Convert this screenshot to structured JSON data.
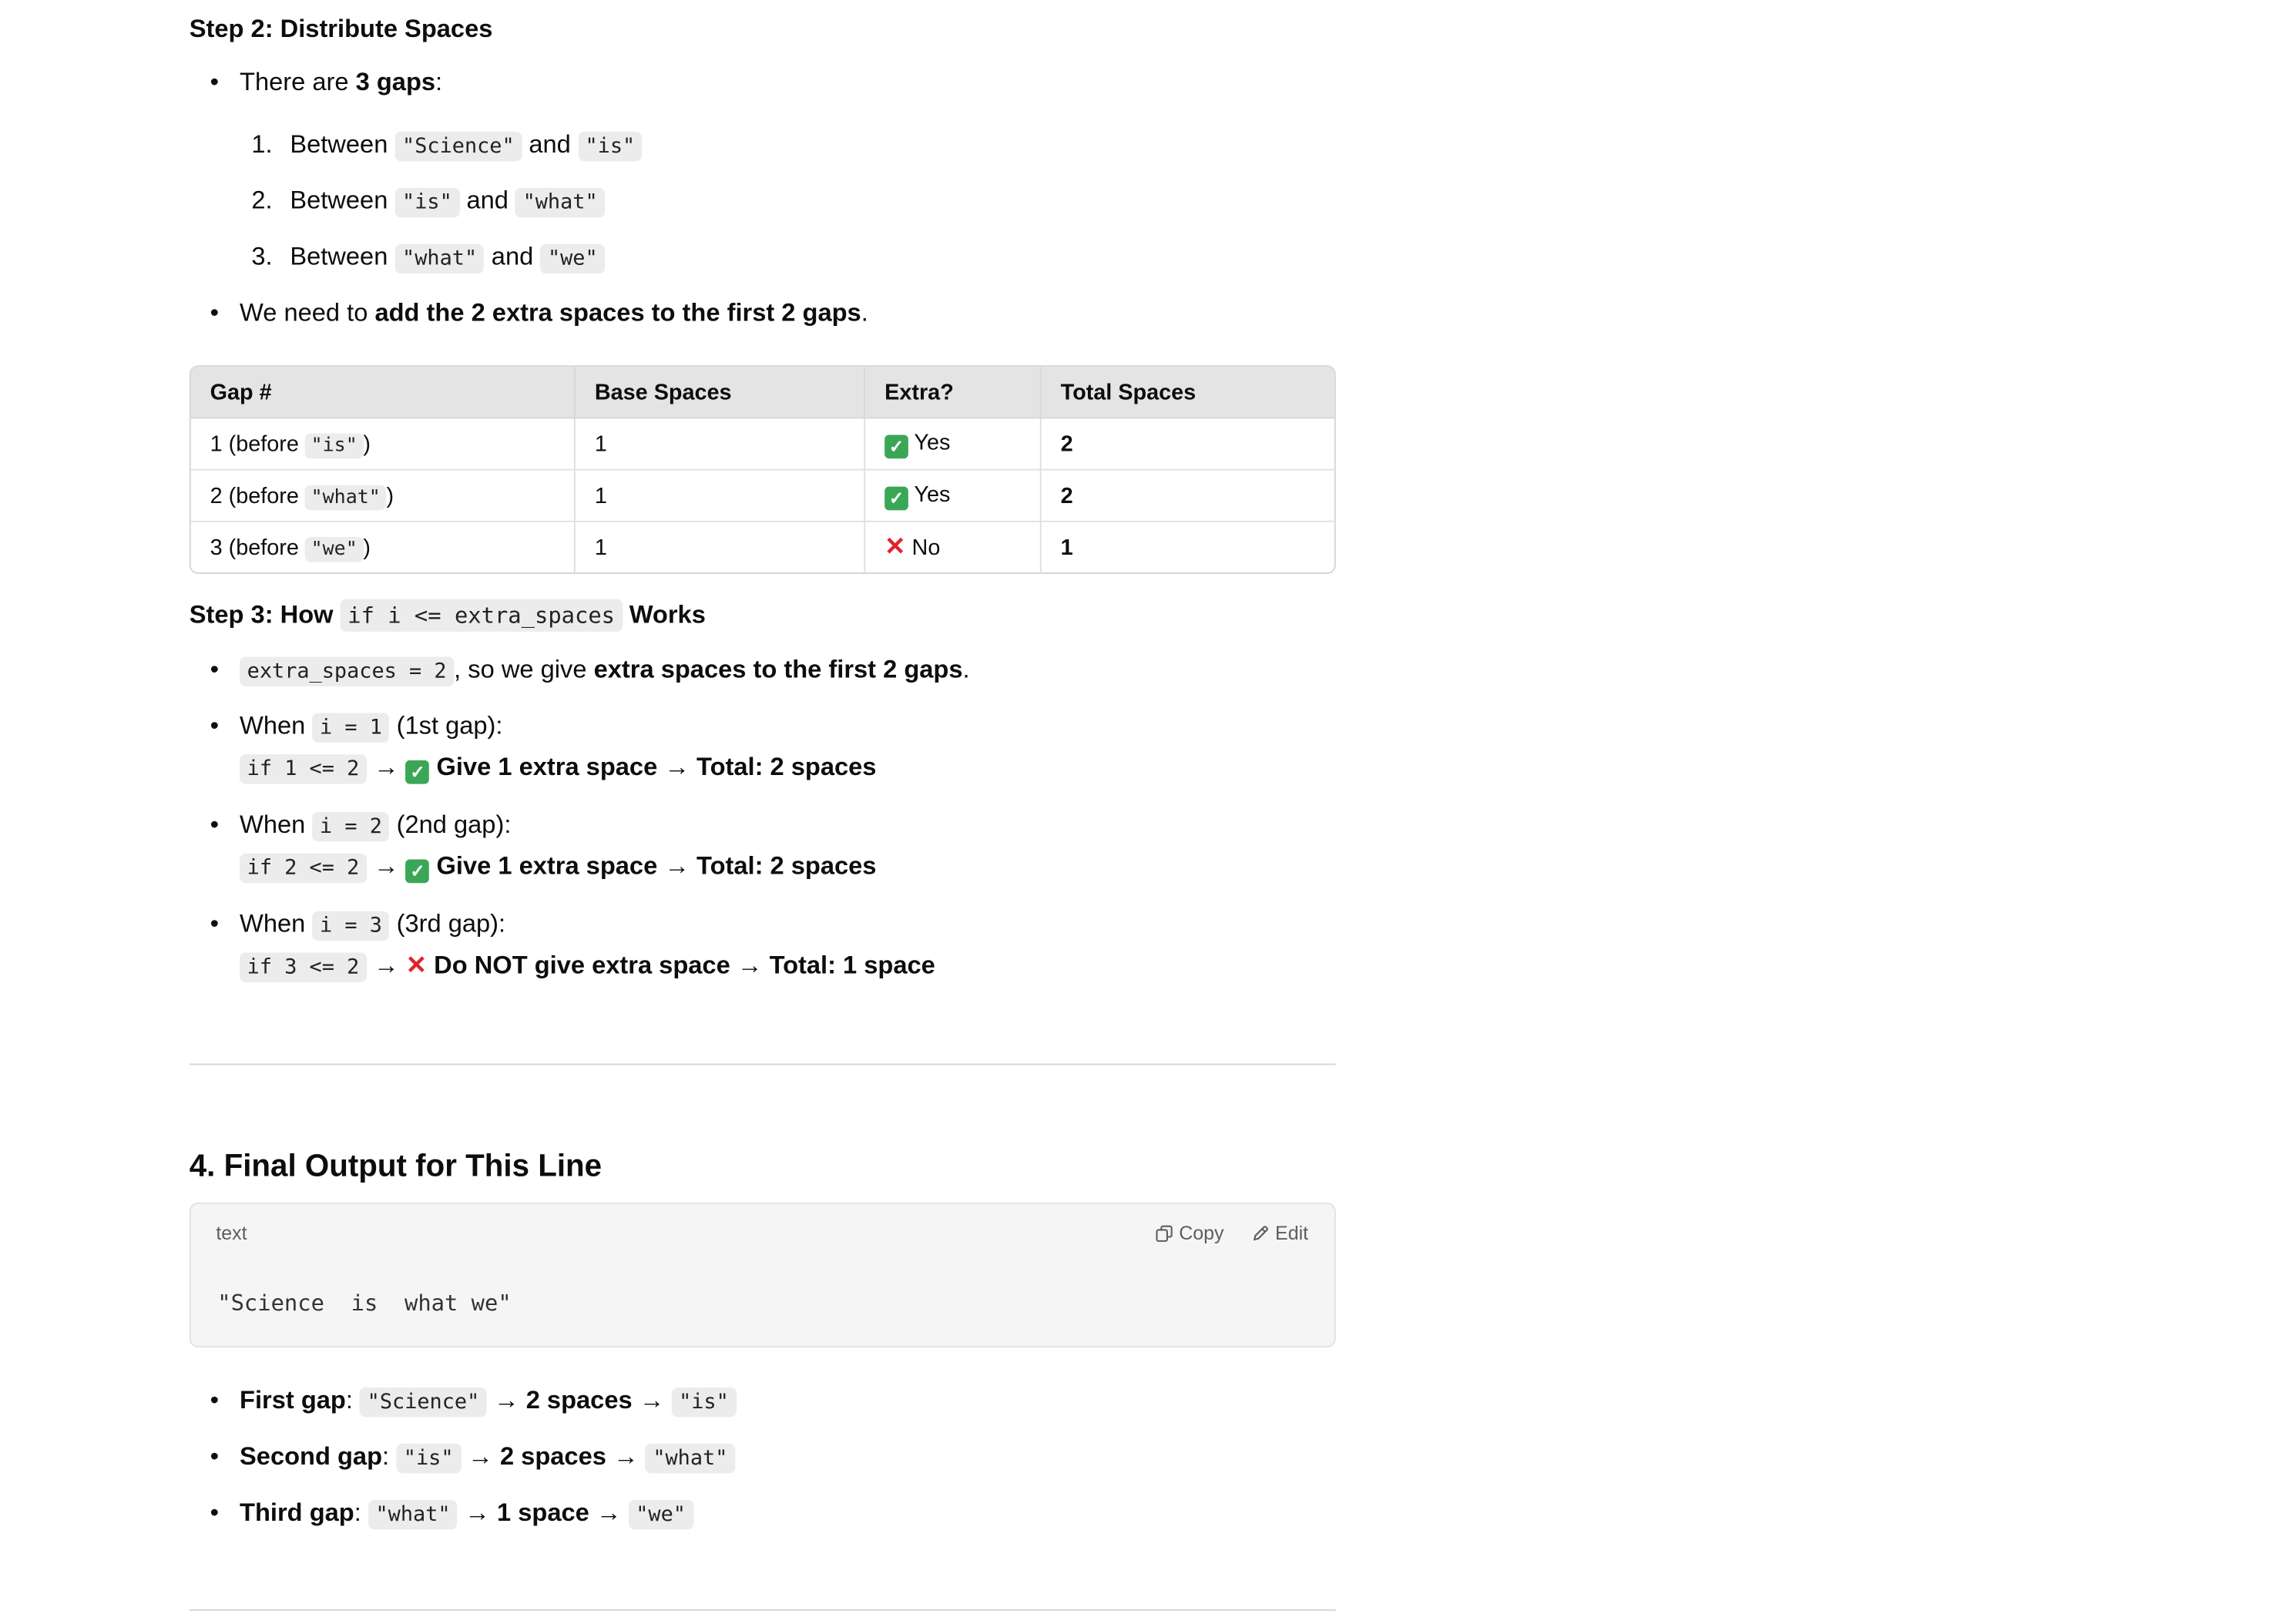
{
  "step2": {
    "heading": "Step 2: Distribute Spaces",
    "gaps_intro_prefix": "There are ",
    "gaps_intro_bold": "3 gaps",
    "gaps_intro_suffix": ":",
    "gaps": [
      {
        "num": "1.",
        "prefix": "Between ",
        "a": "\"Science\"",
        "mid": " and ",
        "b": "\"is\""
      },
      {
        "num": "2.",
        "prefix": "Between ",
        "a": "\"is\"",
        "mid": " and ",
        "b": "\"what\""
      },
      {
        "num": "3.",
        "prefix": "Between ",
        "a": "\"what\"",
        "mid": " and ",
        "b": "\"we\""
      }
    ],
    "need_prefix": "We need to ",
    "need_bold": "add the 2 extra spaces to the first 2 gaps",
    "need_suffix": "."
  },
  "table": {
    "headers": [
      "Gap #",
      "Base Spaces",
      "Extra?",
      "Total Spaces"
    ],
    "rows": [
      {
        "gap_prefix": "1 (before ",
        "gap_code": "\"is\"",
        "gap_suffix": ")",
        "base": "1",
        "extra": "Yes",
        "extra_icon": "check-icon",
        "total": "2"
      },
      {
        "gap_prefix": "2 (before ",
        "gap_code": "\"what\"",
        "gap_suffix": ")",
        "base": "1",
        "extra": "Yes",
        "extra_icon": "check-icon",
        "total": "2"
      },
      {
        "gap_prefix": "3 (before ",
        "gap_code": "\"we\"",
        "gap_suffix": ")",
        "base": "1",
        "extra": "No",
        "extra_icon": "cross-icon",
        "total": "1"
      }
    ]
  },
  "step3": {
    "heading_prefix": "Step 3: How ",
    "heading_code": "if i <= extra_spaces",
    "heading_suffix": " Works",
    "b1_code": "extra_spaces = 2",
    "b1_text": ", so we give ",
    "b1_bold": "extra spaces to the first 2 gaps",
    "b1_end": ".",
    "items": [
      {
        "when": "When ",
        "code": "i = 1",
        "note": " (1st gap):",
        "cond": "if 1 <= 2",
        "result": "Give 1 extra space",
        "total": "Total: 2 spaces",
        "icon": "check-icon"
      },
      {
        "when": "When ",
        "code": "i = 2",
        "note": " (2nd gap):",
        "cond": "if 2 <= 2",
        "result": "Give 1 extra space",
        "total": "Total: 2 spaces",
        "icon": "check-icon"
      },
      {
        "when": "When ",
        "code": "i = 3",
        "note": " (3rd gap):",
        "cond": "if 3 <= 2",
        "result": "Do NOT give extra space",
        "total": "Total: 1 space",
        "icon": "cross-icon"
      }
    ],
    "arrow": "→"
  },
  "section4": {
    "heading": "4. Final Output for This Line",
    "code_lang": "text",
    "copy_label": "Copy",
    "edit_label": "Edit",
    "code": "\"Science  is  what we\"",
    "summary": [
      {
        "label": "First gap",
        "a": "\"Science\"",
        "spaces": "2 spaces",
        "b": "\"is\""
      },
      {
        "label": "Second gap",
        "a": "\"is\"",
        "spaces": "2 spaces",
        "b": "\"what\""
      },
      {
        "label": "Third gap",
        "a": "\"what\"",
        "spaces": "1 space",
        "b": "\"we\""
      }
    ]
  },
  "colors": {
    "check": "#3aa757",
    "cross": "#e0242e",
    "code_bg": "#ececec"
  }
}
